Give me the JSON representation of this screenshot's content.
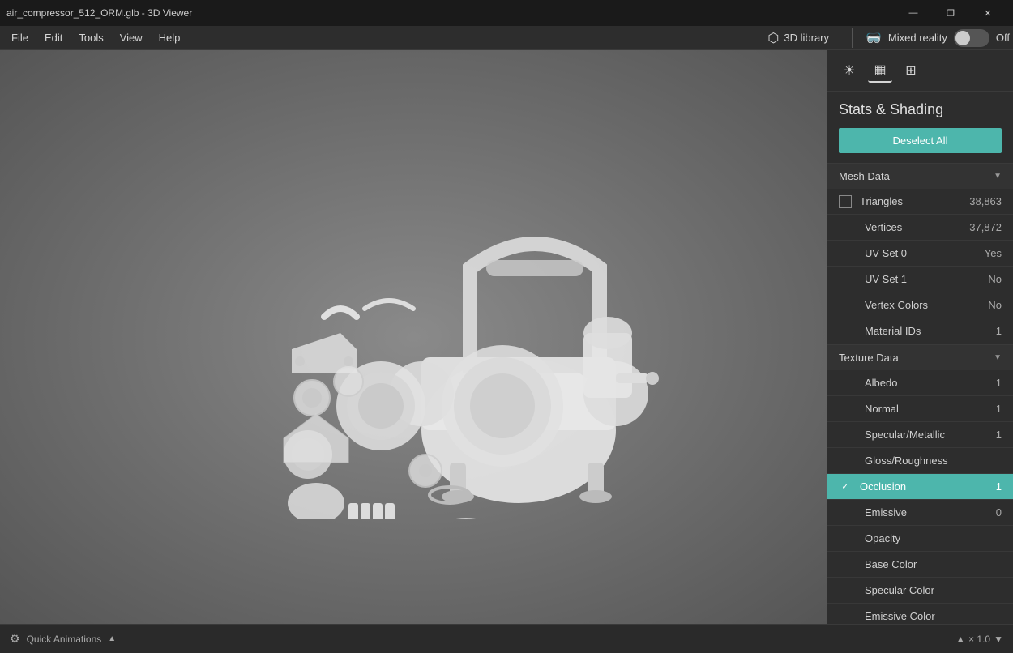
{
  "titlebar": {
    "title": "air_compressor_512_ORM.glb - 3D Viewer",
    "minimize_label": "—",
    "restore_label": "❐",
    "close_label": "✕"
  },
  "menubar": {
    "items": [
      "File",
      "Edit",
      "Tools",
      "View",
      "Help"
    ]
  },
  "toolbar": {
    "library_label": "3D library",
    "mixed_reality_label": "Mixed reality",
    "off_label": "Off"
  },
  "panel": {
    "title": "Stats & Shading",
    "deselect_label": "Deselect All",
    "icons": [
      {
        "name": "sun-icon",
        "symbol": "☀"
      },
      {
        "name": "grid-icon",
        "symbol": "▦"
      },
      {
        "name": "table-icon",
        "symbol": "⊞"
      }
    ],
    "sections": {
      "mesh_data": {
        "label": "Mesh Data",
        "rows": [
          {
            "key": "triangles",
            "label": "Triangles",
            "value": "38,863",
            "has_checkbox": true,
            "checked": false,
            "highlighted": false
          },
          {
            "key": "vertices",
            "label": "Vertices",
            "value": "37,872",
            "has_checkbox": false,
            "checked": false,
            "highlighted": false
          },
          {
            "key": "uv_set_0",
            "label": "UV Set 0",
            "value": "Yes",
            "has_checkbox": false,
            "highlighted": false
          },
          {
            "key": "uv_set_1",
            "label": "UV Set 1",
            "value": "No",
            "has_checkbox": false,
            "highlighted": false
          },
          {
            "key": "vertex_colors",
            "label": "Vertex Colors",
            "value": "No",
            "has_checkbox": false,
            "highlighted": false
          },
          {
            "key": "material_ids",
            "label": "Material IDs",
            "value": "1",
            "has_checkbox": false,
            "highlighted": false
          }
        ]
      },
      "texture_data": {
        "label": "Texture Data",
        "rows": [
          {
            "key": "albedo",
            "label": "Albedo",
            "value": "1",
            "has_checkbox": false,
            "highlighted": false
          },
          {
            "key": "normal",
            "label": "Normal",
            "value": "1",
            "has_checkbox": false,
            "highlighted": false
          },
          {
            "key": "specular_metallic",
            "label": "Specular/Metallic",
            "value": "1",
            "has_checkbox": false,
            "highlighted": false
          },
          {
            "key": "gloss_roughness",
            "label": "Gloss/Roughness",
            "value": "",
            "has_checkbox": false,
            "highlighted": false
          },
          {
            "key": "occlusion",
            "label": "Occlusion",
            "value": "1",
            "has_checkbox": true,
            "checked": true,
            "highlighted": true
          },
          {
            "key": "emissive",
            "label": "Emissive",
            "value": "0",
            "has_checkbox": false,
            "highlighted": false
          },
          {
            "key": "opacity",
            "label": "Opacity",
            "value": "",
            "has_checkbox": false,
            "highlighted": false
          },
          {
            "key": "base_color",
            "label": "Base Color",
            "value": "",
            "has_checkbox": false,
            "highlighted": false
          },
          {
            "key": "specular_color",
            "label": "Specular Color",
            "value": "",
            "has_checkbox": false,
            "highlighted": false
          },
          {
            "key": "emissive_color",
            "label": "Emissive Color",
            "value": "",
            "has_checkbox": false,
            "highlighted": false
          }
        ]
      }
    }
  },
  "bottombar": {
    "quick_animations_label": "Quick Animations",
    "zoom_label": "× 1.0"
  }
}
